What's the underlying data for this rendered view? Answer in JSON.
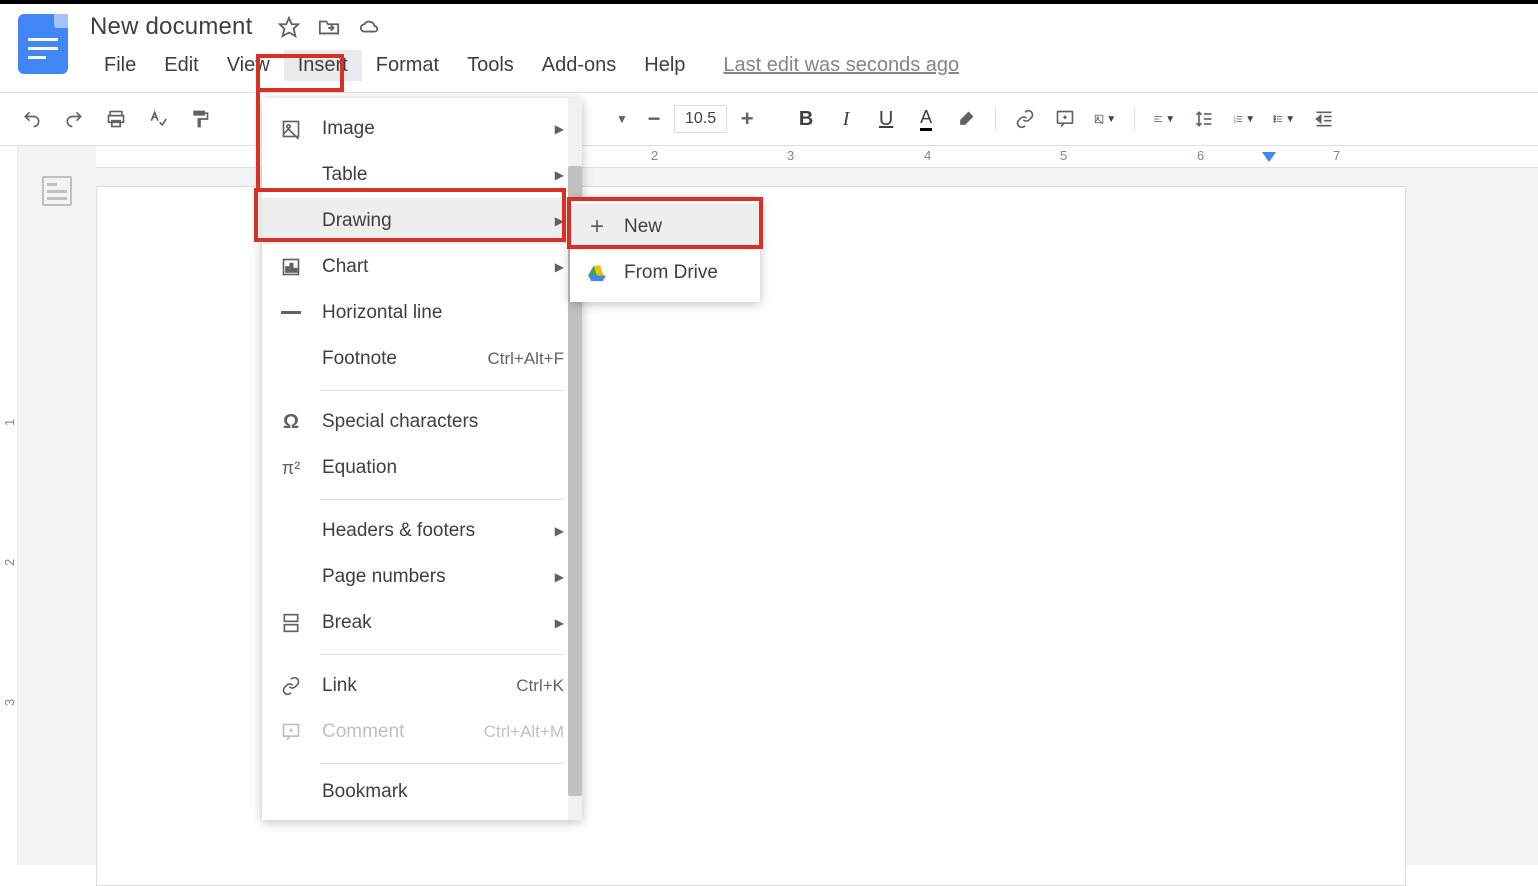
{
  "doc": {
    "title": "New document"
  },
  "menubar": {
    "items": [
      "File",
      "Edit",
      "View",
      "Insert",
      "Format",
      "Tools",
      "Add-ons",
      "Help"
    ],
    "last_edit": "Last edit was seconds ago"
  },
  "toolbar": {
    "font_size": "10.5"
  },
  "ruler": {
    "h": [
      "2",
      "3",
      "4",
      "5",
      "6",
      "7"
    ],
    "v": [
      "1",
      "2",
      "3"
    ]
  },
  "insert_menu": {
    "image": "Image",
    "table": "Table",
    "drawing": "Drawing",
    "chart": "Chart",
    "horizontal_line": "Horizontal line",
    "footnote": "Footnote",
    "footnote_shortcut": "Ctrl+Alt+F",
    "special_chars": "Special characters",
    "equation": "Equation",
    "headers_footers": "Headers & footers",
    "page_numbers": "Page numbers",
    "break": "Break",
    "link": "Link",
    "link_shortcut": "Ctrl+K",
    "comment": "Comment",
    "comment_shortcut": "Ctrl+Alt+M",
    "bookmark": "Bookmark"
  },
  "drawing_submenu": {
    "new": "New",
    "from_drive": "From Drive"
  }
}
